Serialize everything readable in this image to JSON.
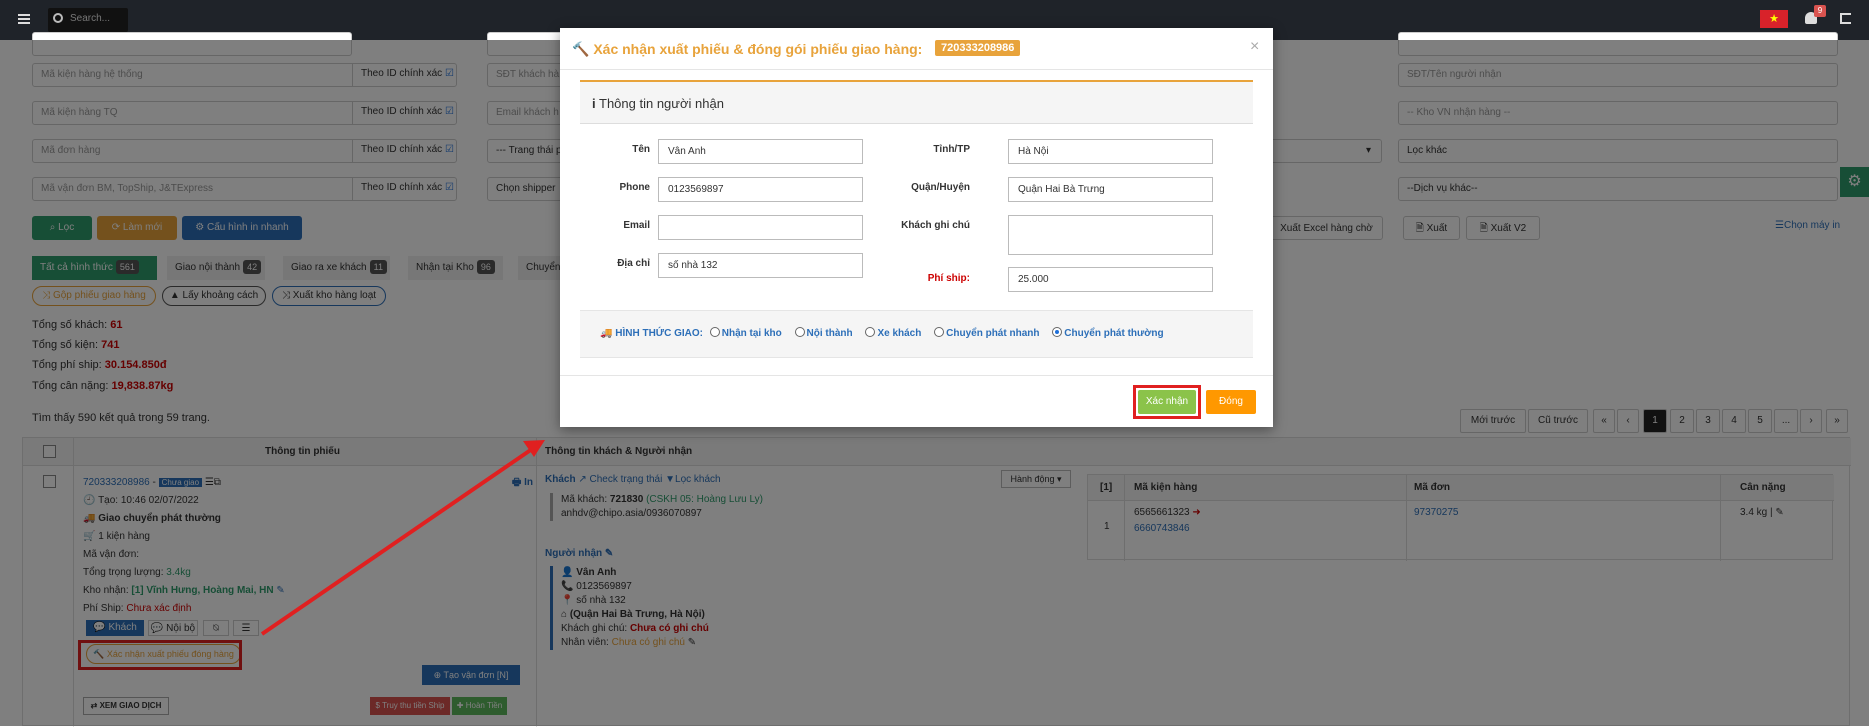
{
  "topbar": {
    "search_placeholder": "Search...",
    "notif_count": "9"
  },
  "filters": {
    "col1": [
      "",
      "Mã kiện hàng hệ thống",
      "Mã kiện hàng TQ",
      "Mã đơn hàng",
      "Mã vận đơn BM, TopShip, J&TExpress"
    ],
    "id_exact": "Theo ID chính xác",
    "col3": [
      "SĐT khách hà",
      "Email khách h",
      "--- Trang thái p",
      "Chọn shipper"
    ],
    "col5": [
      "",
      "SĐT/Tên người nhận",
      "-- Kho VN nhận hàng --",
      "Lọc khác",
      "--Dịch vụ khác--"
    ]
  },
  "actions": {
    "filter": "Lọc",
    "reset": "Làm mới",
    "print_config": "Cấu hình in nhanh",
    "export_excel": "Xuất Excel hàng chờ",
    "export": "Xuất",
    "export_v2": "Xuất V2",
    "choose_printer": "Chọn máy in"
  },
  "tabs": [
    {
      "label": "Tất cả hình thức",
      "count": "561"
    },
    {
      "label": "Giao nội thành",
      "count": "42"
    },
    {
      "label": "Giao ra xe khách",
      "count": "11"
    },
    {
      "label": "Nhận tại Kho",
      "count": "96"
    },
    {
      "label": "Chuyển",
      "count": ""
    }
  ],
  "pills": {
    "merge": "Gộp phiếu giao hàng",
    "distance": "Lấy khoảng cách",
    "export_batch": "Xuất kho hàng loạt"
  },
  "stats": [
    {
      "label": "Tổng số khách: ",
      "value": "61"
    },
    {
      "label": "Tổng số kiện: ",
      "value": "741"
    },
    {
      "label": "Tổng phí ship: ",
      "value": "30.154.850đ"
    },
    {
      "label": "Tổng cân nặng: ",
      "value": "19,838.87kg"
    }
  ],
  "results": "Tìm thấy 590 kết quả trong 59 trang.",
  "pagination": {
    "newer": "Mới trước",
    "older": "Cũ trước",
    "first": "«",
    "prev": "‹",
    "pages": [
      "1",
      "2",
      "3",
      "4",
      "5",
      "..."
    ],
    "next": "›",
    "last": "»"
  },
  "table": {
    "col_ticket": "Thông tin phiếu",
    "col_customer": "Thông tin khách & Người nhận",
    "ticket": {
      "id": "720333208986",
      "status": "Chưa giao",
      "print": "In",
      "created": "Tạo: 10:46 02/07/2022",
      "method": "Giao chuyển phát thường",
      "packages": "1 kiện hàng",
      "tracking": "Mã vận đơn:",
      "weight_label": "Tổng trọng lượng: ",
      "weight": "3.4kg",
      "warehouse_label": "Kho nhận: ",
      "warehouse": "[1] Vĩnh Hưng, Hoàng Mai, HN",
      "ship_label": "Phí Ship: ",
      "ship": "Chưa xác định",
      "tab_customer": "Khách",
      "tab_internal": "Nội bộ",
      "confirm_pack": "Xác nhận xuất phiếu đóng hàng",
      "create_waybill": "Tạo vận đơn [N]",
      "view_tx": "XEM GIAO DỊCH",
      "trace_ship": "Truy thu tiền Ship",
      "refund": "Hoàn Tiền"
    },
    "customer": {
      "label": "Khách",
      "check": "Check trạng thái",
      "filter": "Lọc khách",
      "action": "Hành động",
      "code_label": "Mã khách: ",
      "code": "721830",
      "care": "(CSKH 05: Hoàng Lưu Ly)",
      "contact": "anhdv@chipo.asia/0936070897",
      "recipient_label": "Người nhận",
      "r_name": "Vân Anh",
      "r_phone": "0123569897",
      "r_addr": "số nhà 132",
      "r_district": "(Quận Hai Bà Trưng, Hà Nội)",
      "note_label": "Khách ghi chú: ",
      "note": "Chưa có ghi chú",
      "staff_label": "Nhân viên: ",
      "staff": "Chưa có ghi chú"
    },
    "packages": {
      "headers": [
        "[1]",
        "Mã kiện hàng",
        "Mã đơn",
        "Cân nặng"
      ],
      "rows": [
        {
          "idx": "1",
          "code": "6565661323",
          "code2": "6660743846",
          "order": "97370275",
          "weight": "3.4 kg |"
        }
      ]
    }
  },
  "modal": {
    "title": "Xác nhận xuất phiếu & đóng gói phiếu giao hàng:",
    "ticket": "720333208986",
    "close": "×",
    "section": "Thông tin người nhận",
    "fields": {
      "name_label": "Tên",
      "name": "Vân Anh",
      "phone_label": "Phone",
      "phone": "0123569897",
      "email_label": "Email",
      "email": "",
      "address_label": "Địa chỉ",
      "address": "số nhà 132",
      "province_label": "Tỉnh/TP",
      "province": "Hà Nội",
      "district_label": "Quận/Huyện",
      "district": "Quận Hai Bà Trưng",
      "note_label": "Khách ghi chú",
      "note": "",
      "ship_label": "Phí ship:",
      "ship": "25.000"
    },
    "delivery_label": "HÌNH THỨC GIAO:",
    "delivery_options": [
      "Nhận tại kho",
      "Nội thành",
      "Xe khách",
      "Chuyển phát nhanh",
      "Chuyển phát thường"
    ],
    "delivery_selected": 4,
    "confirm": "Xác nhận",
    "cancel": "Đóng"
  },
  "colors": {
    "accent_orange": "#e8a33b",
    "green": "#2e9c6c",
    "blue": "#2d6fb8",
    "red_highlight": "#e02020"
  }
}
